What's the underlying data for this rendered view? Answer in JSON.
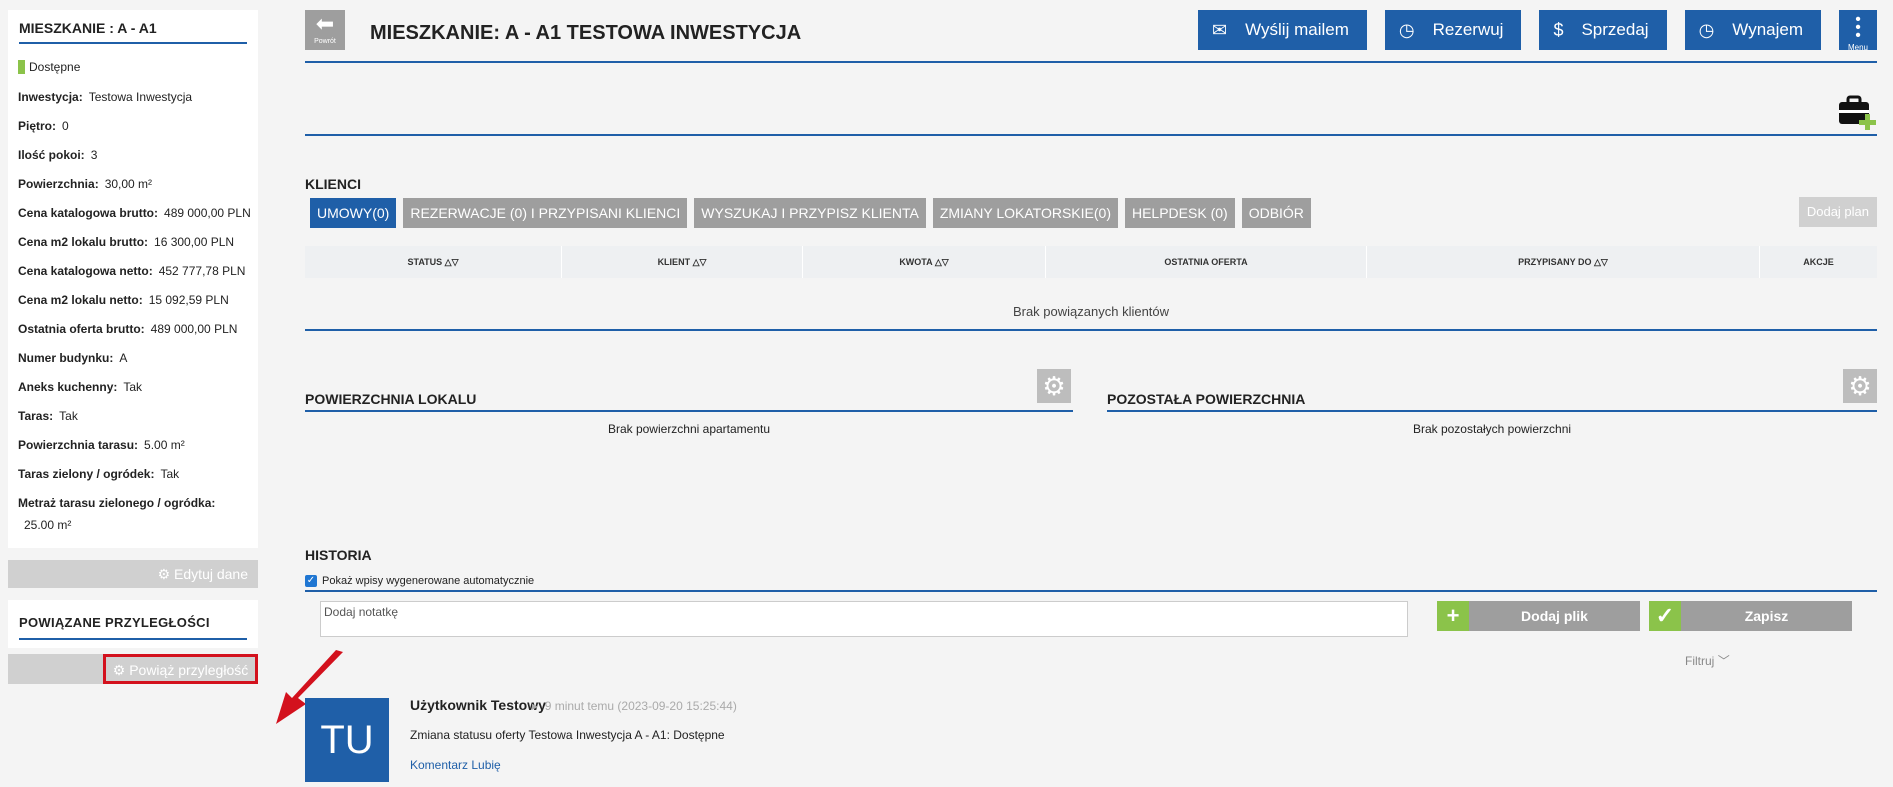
{
  "sidebar": {
    "title": "MIESZKANIE : A - A1",
    "status": "Dostępne",
    "props": [
      {
        "label": "Inwestycja:",
        "value": "Testowa Inwestycja"
      },
      {
        "label": "Piętro:",
        "value": "0"
      },
      {
        "label": "Ilość pokoi:",
        "value": "3"
      },
      {
        "label": "Powierzchnia:",
        "value": "30,00 m²"
      },
      {
        "label": "Cena katalogowa brutto:",
        "value": "489 000,00 PLN"
      },
      {
        "label": "Cena m2 lokalu brutto:",
        "value": "16 300,00 PLN"
      },
      {
        "label": "Cena katalogowa netto:",
        "value": "452 777,78 PLN"
      },
      {
        "label": "Cena m2 lokalu netto:",
        "value": "15 092,59 PLN"
      },
      {
        "label": "Ostatnia oferta brutto:",
        "value": "489 000,00 PLN"
      },
      {
        "label": "Numer budynku:",
        "value": "A"
      },
      {
        "label": "Aneks kuchenny:",
        "value": "Tak"
      },
      {
        "label": "Taras:",
        "value": "Tak"
      },
      {
        "label": "Powierzchnia tarasu:",
        "value": "5.00 m²"
      },
      {
        "label": "Taras zielony / ogródek:",
        "value": "Tak"
      },
      {
        "label": "Metraż tarasu zielonego / ogródka:",
        "value": "25.00 m²"
      }
    ],
    "edit_label": "⚙ Edytuj dane",
    "related_title": "POWIĄZANE PRZYLEGŁOŚCI",
    "related_button": "⚙ Powiąż przyległość"
  },
  "header": {
    "back_label": "Powrót",
    "title": "MIESZKANIE: A - A1 TESTOWA INWESTYCJA",
    "buttons": [
      {
        "icon": "envelope-icon",
        "label": "Wyślij mailem"
      },
      {
        "icon": "clock-icon",
        "label": "Rezerwuj"
      },
      {
        "icon": "dollar-icon",
        "label": "Sprzedaj"
      },
      {
        "icon": "clock-icon",
        "label": "Wynajem"
      }
    ],
    "menu_label": "Menu"
  },
  "clients": {
    "title": "KLIENCI",
    "tabs": [
      "UMOWY(0)",
      "REZERWACJE (0) I PRZYPISANI KLIENCI",
      "WYSZUKAJ I PRZYPISZ KLIENTA",
      "ZMIANY LOKATORSKIE(0)",
      "HELPDESK (0)",
      "ODBIÓR"
    ],
    "add_plan": "Dodaj plan",
    "columns": [
      "STATUS",
      "KLIENT",
      "KWOTA",
      "OSTATNIA OFERTA",
      "PRZYPISANY DO",
      "AKCJE"
    ],
    "empty": "Brak powiązanych klientów"
  },
  "surface": {
    "title": "POWIERZCHNIA LOKALU",
    "empty": "Brak powierzchni apartamentu",
    "other_title": "POZOSTAŁA POWIERZCHNIA",
    "other_empty": "Brak pozostałych powierzchni"
  },
  "history": {
    "title": "HISTORIA",
    "checkbox_label": "Pokaż wpisy wygenerowane automatycznie",
    "note_placeholder": "Dodaj notatkę",
    "add_file": "Dodaj plik",
    "save": "Zapisz",
    "filter": "Filtruj",
    "entry": {
      "initials": "TU",
      "user": "Użytkownik Testowy",
      "time": "9 minut temu (2023-09-20 15:25:44)",
      "text": "Zmiana statusu oferty Testowa Inwestycja A - A1: Dostępne",
      "links": "Komentarz Lubię"
    }
  },
  "colors": {
    "accent": "#1f5fa8",
    "green": "#8bc34a",
    "highlight": "#d3111d"
  }
}
